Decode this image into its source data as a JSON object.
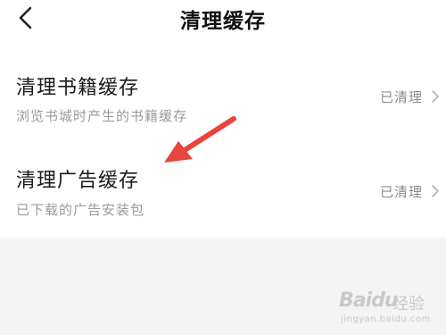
{
  "header": {
    "title": "清理缓存",
    "back_icon": "chevron-left-icon"
  },
  "items": [
    {
      "title": "清理书籍缓存",
      "description": "浏览书城时产生的书籍缓存",
      "status": "已清理"
    },
    {
      "title": "清理广告缓存",
      "description": "已下载的广告安装包",
      "status": "已清理"
    }
  ],
  "annotation": {
    "arrow_color": "#e8453c"
  },
  "watermark": {
    "logo": "Baidu",
    "label": "经验",
    "url": "jingyan.baidu.com"
  }
}
